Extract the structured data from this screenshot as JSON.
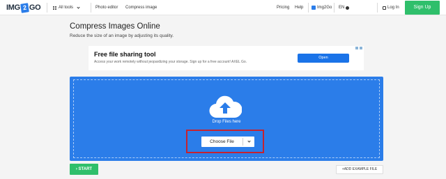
{
  "header": {
    "logo": {
      "part1": "IMG",
      "part2": "2",
      "part3": "GO"
    },
    "all_tools": "All tools",
    "nav": {
      "photo_editor": "Photo editor",
      "compress_image": "Compress image"
    },
    "right": {
      "pricing": "Pricing",
      "help": "Help",
      "img2go": "Img2Go",
      "lang": "EN",
      "login": "Log In",
      "signup": "Sign Up"
    }
  },
  "page": {
    "title": "Compress Images Online",
    "subtitle": "Reduce the size of an image by adjusting its quality."
  },
  "ad": {
    "title": "Free file sharing tool",
    "text": "Access your work remotely without jeopardizing your storage. Sign up for a free account! AXEL Go.",
    "button": "Open"
  },
  "upload": {
    "drop_text": "Drop Files here",
    "choose_label": "Choose File"
  },
  "actions": {
    "start": "START",
    "start_icon": "chevron-right",
    "add_example": "ADD EXAMPLE FILE"
  },
  "colors": {
    "accent_blue": "#2b7de9",
    "green": "#2fbf6b",
    "highlight_red": "#c6222f"
  }
}
